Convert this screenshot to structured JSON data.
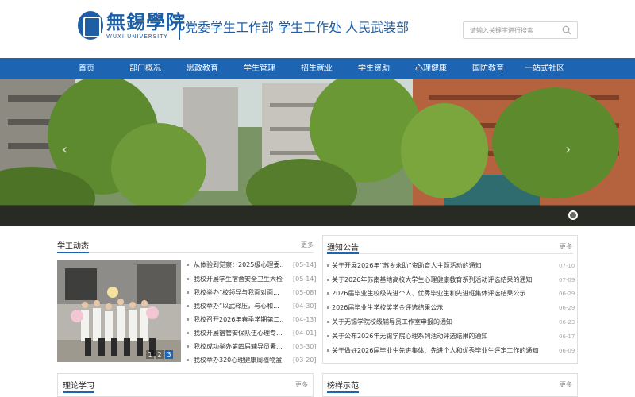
{
  "header": {
    "logo_cn": "無錫學院",
    "logo_en": "WUXI UNIVERSITY",
    "dept_title": "党委学生工作部 学生工作处 人民武装部",
    "search_placeholder": "请输入关键字进行搜索"
  },
  "nav": {
    "items": [
      "首页",
      "部门概况",
      "思政教育",
      "学生管理",
      "招生就业",
      "学生资助",
      "心理健康",
      "国防教育",
      "一站式社区"
    ]
  },
  "banner": {
    "prev_label": "‹",
    "next_label": "›",
    "active_slide": 1
  },
  "news": {
    "title": "学工动态",
    "more": "更多",
    "pager": [
      "1",
      "2",
      "3"
    ],
    "active_page": "3",
    "items": [
      {
        "title": "从体验到觉察：2025级心理委...",
        "date": "[05-14]"
      },
      {
        "title": "我校开展学生宿舍安全卫生大检查",
        "date": "[05-14]"
      },
      {
        "title": "我校举办“校领导与我面对面...",
        "date": "[05-08]"
      },
      {
        "title": "我校举办“以武释压，与心和...",
        "date": "[04-30]"
      },
      {
        "title": "我校召开2026年春季学期第二...",
        "date": "[04-13]"
      },
      {
        "title": "我校开展宿管安保队伍心理专...",
        "date": "[04-01]"
      },
      {
        "title": "我校成功举办第四届辅导员素...",
        "date": "[03-30]"
      },
      {
        "title": "我校举办320心理健康周植物盆...",
        "date": "[03-20]"
      }
    ]
  },
  "notice": {
    "title": "通知公告",
    "more": "更多",
    "items": [
      {
        "title": "关于开展2026年“苏乡永助”资助育人主题活动的通知",
        "date": "07-10"
      },
      {
        "title": "关于2026年苏南基地高校大学生心理健康教育系列活动评选结果的通知",
        "date": "07-09"
      },
      {
        "title": "2026届毕业生校级先进个人、优秀毕业生和先进班集体评选结果公示",
        "date": "06-29"
      },
      {
        "title": "2026届毕业生学校奖学金评选结果公示",
        "date": "06-29"
      },
      {
        "title": "关于无锡学院校级辅导员工作室申报的通知",
        "date": "06-23"
      },
      {
        "title": "关于公布2026年无锡学院心理系列活动评选结果的通知",
        "date": "06-17"
      },
      {
        "title": "关于做好2026届毕业生先进集体、先进个人和优秀毕业生评定工作的通知",
        "date": "06-09"
      }
    ]
  },
  "theory": {
    "title": "理论学习",
    "more": "更多"
  },
  "models": {
    "title": "榜样示范",
    "more": "更多"
  },
  "colors": {
    "brand": "#1d65b3",
    "brand_dark": "#1d5ea4"
  }
}
